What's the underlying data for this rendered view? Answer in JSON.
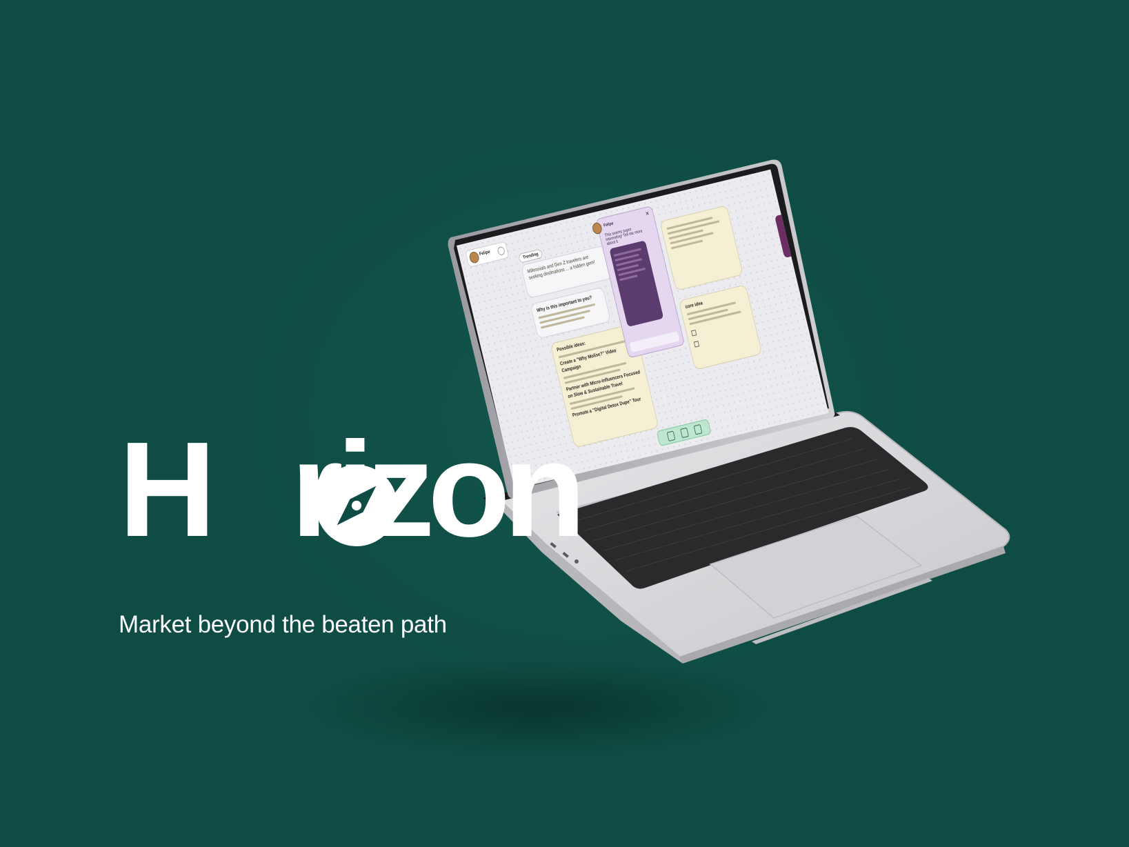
{
  "brand": {
    "wordmark_first": "H",
    "wordmark_rest": "rizon",
    "logo_icon": "compass-icon",
    "tagline": "Market beyond the beaten path"
  },
  "colors": {
    "background": "#0f4d44",
    "text": "#ffffff",
    "laptop_body": "#d9d9dc",
    "keyboard": "#2a2a2c"
  },
  "screen_ui": {
    "user": {
      "name": "Felipe"
    },
    "chip_trending": "Trending",
    "card_intro": "Millennials and Gen Z travelers are seeking destinations ... a hidden gem!",
    "card_why_title": "Why is this important to you?",
    "card_ideas_title": "Possible ideas:",
    "idea_1": "Create a \"Why Molise?\" Video Campaign",
    "idea_2": "Partner with Micro-Influencers Focused on Slow & Sustainable Travel",
    "idea_3": "Promote a \"Digital Detox Dupe\" Tour",
    "card_core_title": "core idea",
    "chat_user": "Felipe",
    "chat_message": "This seems super interesting! Tell me more about it"
  }
}
